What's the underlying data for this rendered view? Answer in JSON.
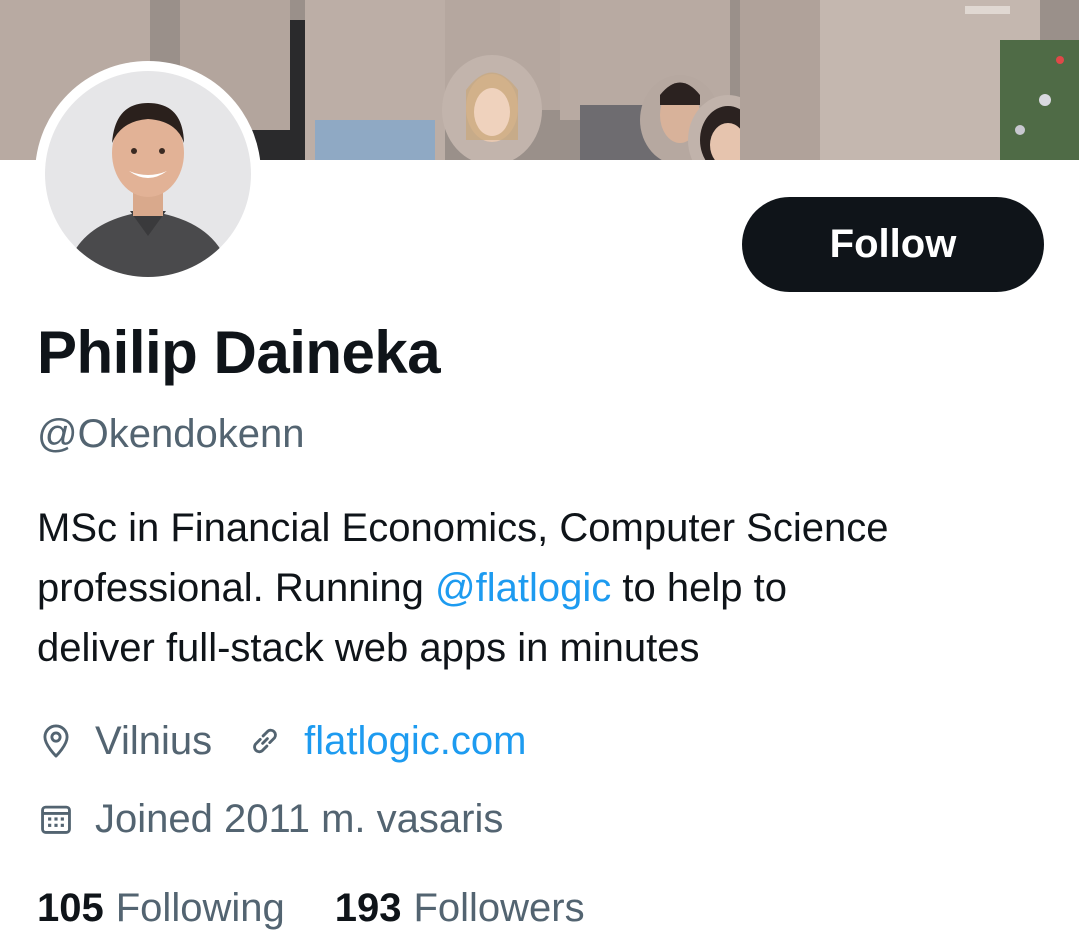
{
  "profile": {
    "display_name": "Philip Daineka",
    "handle": "@Okendokenn",
    "bio": {
      "line1": "MSc in Financial Economics, Computer Science",
      "line2_before": "professional. Running ",
      "line2_mention": "@flatlogic",
      "line2_after": " to help to",
      "line3": "deliver full-stack web apps in minutes"
    },
    "location": "Vilnius",
    "website": "flatlogic.com",
    "joined": "Joined 2011 m. vasaris"
  },
  "actions": {
    "follow_label": "Follow"
  },
  "stats": {
    "following_count": "105",
    "following_label": "Following",
    "followers_count": "193",
    "followers_label": "Followers"
  },
  "icons": {
    "location": "location-pin-icon",
    "website": "link-icon",
    "joined": "calendar-icon"
  },
  "colors": {
    "accent": "#1d9bf0",
    "text_primary": "#0f1419",
    "text_secondary": "#536471",
    "button_bg": "#0f1419"
  }
}
